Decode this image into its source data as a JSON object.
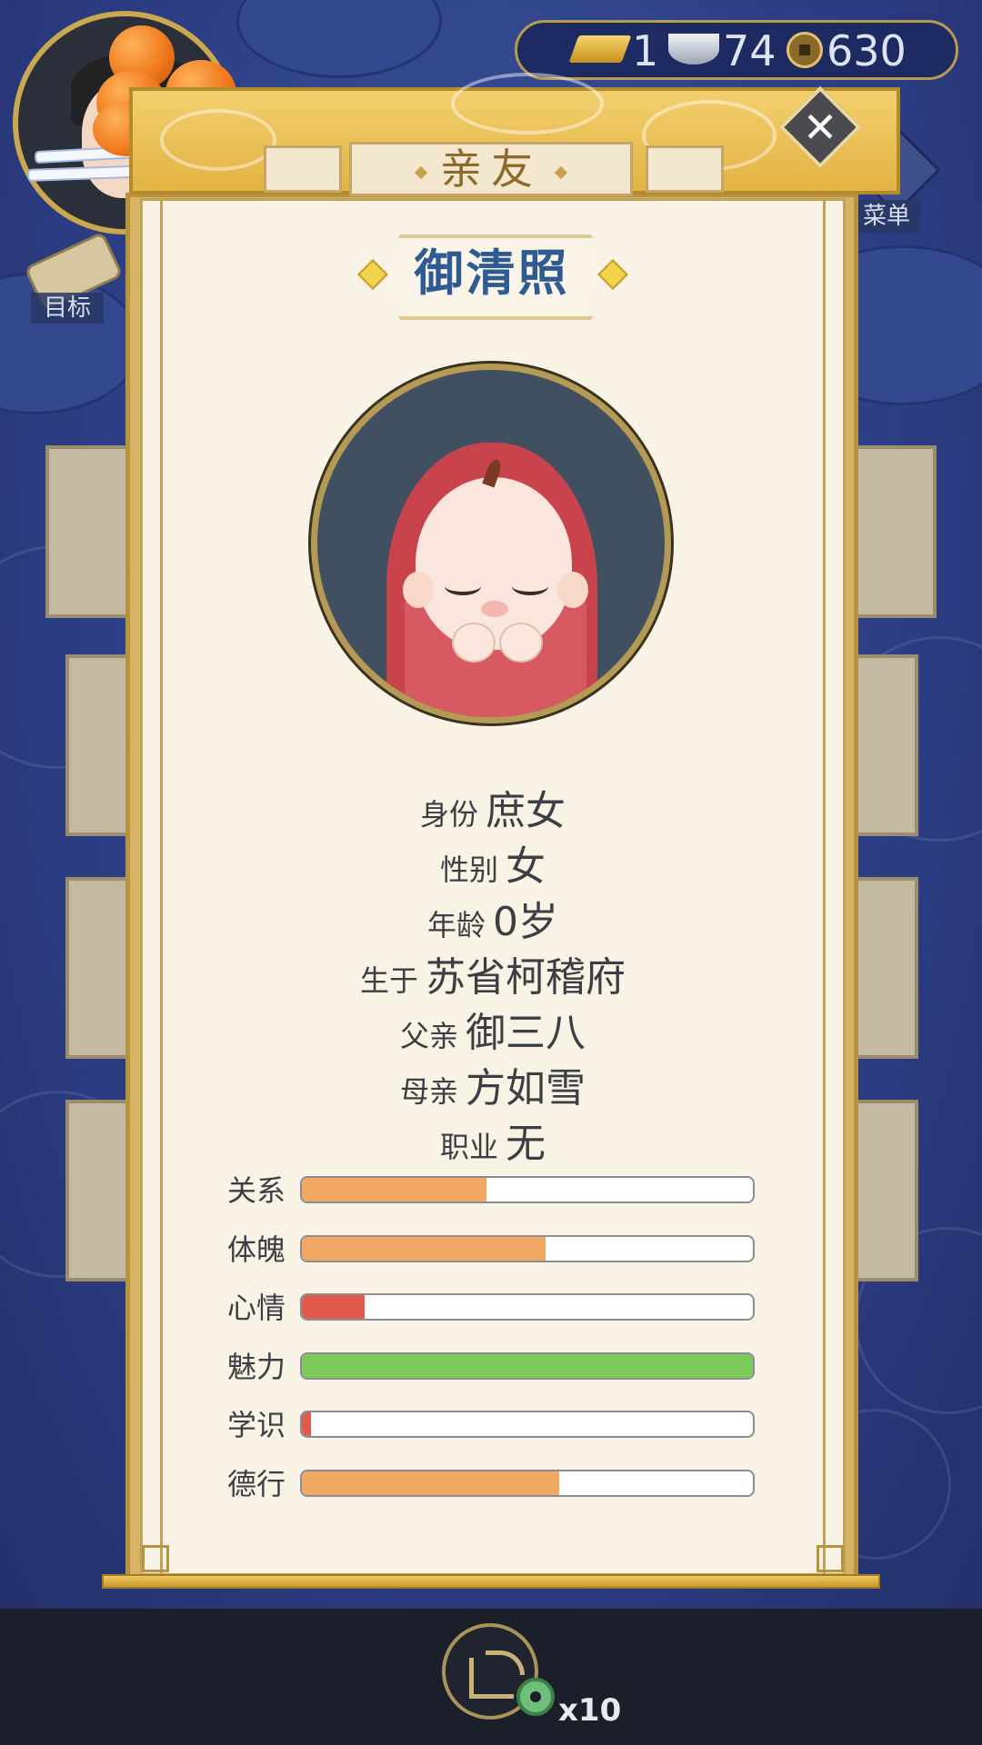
{
  "currency": {
    "gold": "1",
    "silver": "74",
    "copper": "630"
  },
  "nav": {
    "goal_label": "目标",
    "menu_label": "菜单"
  },
  "dialog": {
    "title": "亲友",
    "close_icon": "close-icon",
    "name": "御清照",
    "info": [
      {
        "label": "身份",
        "value": "庶女"
      },
      {
        "label": "性别",
        "value": "女"
      },
      {
        "label": "年龄",
        "value": "0岁"
      },
      {
        "label": "生于",
        "value": "苏省柯稽府"
      },
      {
        "label": "父亲",
        "value": "御三八"
      },
      {
        "label": "母亲",
        "value": "方如雪"
      },
      {
        "label": "职业",
        "value": "无"
      }
    ],
    "stats": [
      {
        "label": "关系",
        "value": 0.41,
        "color": "#f0a862"
      },
      {
        "label": "体魄",
        "value": 0.54,
        "color": "#f0a862"
      },
      {
        "label": "心情",
        "value": 0.14,
        "color": "#e05b4b"
      },
      {
        "label": "魅力",
        "value": 1.0,
        "color": "#7dc95a"
      },
      {
        "label": "学识",
        "value": 0.02,
        "color": "#e05b4b"
      },
      {
        "label": "德行",
        "value": 0.57,
        "color": "#f0a862"
      }
    ]
  },
  "bottom": {
    "share_icon": "share-icon",
    "reward_icon": "jade-coin-icon",
    "reward_count": "x10"
  }
}
